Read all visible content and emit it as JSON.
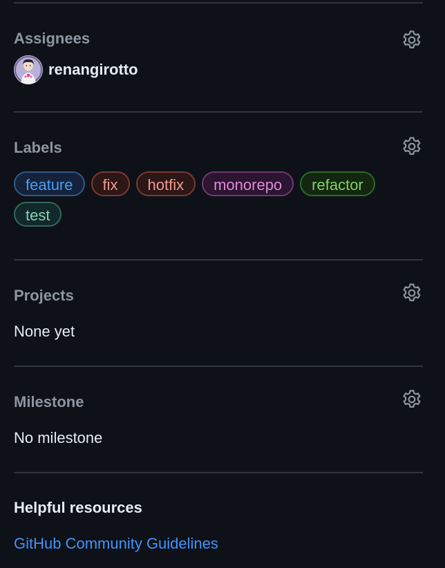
{
  "assignees": {
    "heading": "Assignees",
    "settings_icon": "gear-icon",
    "user": {
      "name": "renangirotto",
      "avatar": "avatar-illustration"
    }
  },
  "labels": {
    "heading": "Labels",
    "settings_icon": "gear-icon",
    "items": [
      {
        "name": "feature",
        "text_color": "#4c9ef0",
        "bg_color": "#14233b",
        "border_color": "#2f5a8a"
      },
      {
        "name": "fix",
        "text_color": "#f19c8f",
        "bg_color": "#2d1616",
        "border_color": "#7a3a35"
      },
      {
        "name": "hotfix",
        "text_color": "#f19c8f",
        "bg_color": "#2d1616",
        "border_color": "#7a3a35"
      },
      {
        "name": "monorepo",
        "text_color": "#e28ad7",
        "bg_color": "#2b1530",
        "border_color": "#6f3a73"
      },
      {
        "name": "refactor",
        "text_color": "#7fd36b",
        "bg_color": "#13260f",
        "border_color": "#2e6a2a"
      },
      {
        "name": "test",
        "text_color": "#82d6b7",
        "bg_color": "#13282a",
        "border_color": "#2e6b5c"
      }
    ]
  },
  "projects": {
    "heading": "Projects",
    "settings_icon": "gear-icon",
    "value": "None yet"
  },
  "milestone": {
    "heading": "Milestone",
    "settings_icon": "gear-icon",
    "value": "No milestone"
  },
  "helpful_resources": {
    "heading": "Helpful resources",
    "link_label": "GitHub Community Guidelines"
  },
  "colors": {
    "background": "#0e1117",
    "divider": "#30363d",
    "heading_muted": "#8d96a0",
    "text": "#e6edf3",
    "link": "#4493f8"
  }
}
